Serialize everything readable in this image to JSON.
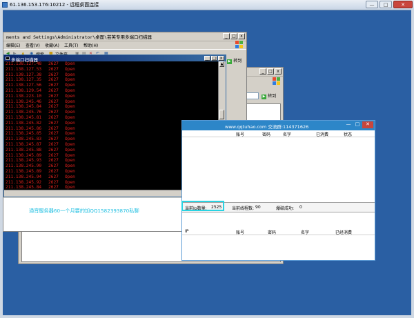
{
  "rdp": {
    "title": "61.136.153.176:10212 - 远程桌面连接",
    "btn_min": "—",
    "btn_max": "□",
    "btn_close": "✕"
  },
  "explorer_main": {
    "title": "ments and Settings\\Administrator\\桌面\\芸芙专用多端口扫描器",
    "menus": [
      "编辑(E)",
      "查看(V)",
      "收藏(A)",
      "工具(T)",
      "帮助(H)"
    ],
    "toolbar_search": "搜索",
    "toolbar_folders": "文件夹",
    "go_label": "转到"
  },
  "explorer_back": {
    "go_label": "转到"
  },
  "console": {
    "title": "多端口扫描器",
    "lines": [
      {
        "ip": "211.138.127.48",
        "port": "2627",
        "status": "Open"
      },
      {
        "ip": "211.138.127.53",
        "port": "2627",
        "status": "Open"
      },
      {
        "ip": "211.138.127.38",
        "port": "2627",
        "status": "Open"
      },
      {
        "ip": "211.138.127.35",
        "port": "2627",
        "status": "Open"
      },
      {
        "ip": "211.138.127.56",
        "port": "2627",
        "status": "Open"
      },
      {
        "ip": "211.138.129.54",
        "port": "2627",
        "status": "Open"
      },
      {
        "ip": "211.138.223.10",
        "port": "2627",
        "status": "Open"
      },
      {
        "ip": "211.138.245.46",
        "port": "2627",
        "status": "Open"
      },
      {
        "ip": "211.138.245.84",
        "port": "2627",
        "status": "Open"
      },
      {
        "ip": "211.138.245.76",
        "port": "2627",
        "status": "Open"
      },
      {
        "ip": "211.138.245.81",
        "port": "2627",
        "status": "Open"
      },
      {
        "ip": "211.138.245.82",
        "port": "2627",
        "status": "Open"
      },
      {
        "ip": "211.138.245.86",
        "port": "2627",
        "status": "Open"
      },
      {
        "ip": "211.138.245.85",
        "port": "2627",
        "status": "Open"
      },
      {
        "ip": "211.138.245.83",
        "port": "2627",
        "status": "Open"
      },
      {
        "ip": "211.138.245.87",
        "port": "2627",
        "status": "Open"
      },
      {
        "ip": "211.138.245.88",
        "port": "2627",
        "status": "Open"
      },
      {
        "ip": "211.138.245.89",
        "port": "2627",
        "status": "Open"
      },
      {
        "ip": "211.138.245.93",
        "port": "2627",
        "status": "Open"
      },
      {
        "ip": "211.138.245.90",
        "port": "2627",
        "status": "Open"
      },
      {
        "ip": "211.138.245.89",
        "port": "2627",
        "status": "Open"
      },
      {
        "ip": "211.138.245.94",
        "port": "2627",
        "status": "Open"
      },
      {
        "ip": "211.138.245.92",
        "port": "2627",
        "status": "Open"
      },
      {
        "ip": "211.138.245.84",
        "port": "2627",
        "status": "Open"
      },
      {
        "ip": "211.138.245.95",
        "port": "2627",
        "status": "Open"
      },
      {
        "ip": "211.138.245.91",
        "port": "2627",
        "status": "Open"
      }
    ]
  },
  "scanner": {
    "title": "www.qqtuhao.com 交流群:114371626",
    "top_cols": [
      "账号",
      "密码",
      "名字",
      "已消费",
      "状态"
    ],
    "status_ip_count_label": "当前Ip数量:",
    "status_ip_count_value": "2525",
    "status_threads_label": "当前线程数:",
    "status_threads_value": "90",
    "status_success_label": "爆破成功:",
    "status_success_value": "0",
    "bottom_cols": [
      "IP",
      "账号",
      "密码",
      "名字",
      "已经消费"
    ]
  },
  "notice": "通宵服务器60一个月要的加QQ1582393870私聊"
}
